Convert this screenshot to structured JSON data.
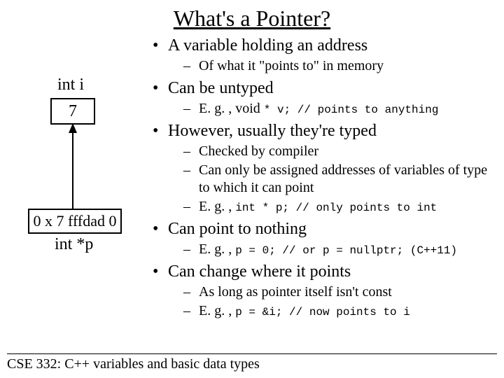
{
  "title": "What's a Pointer?",
  "footer": "CSE 332: C++ variables and basic data types",
  "diagram": {
    "var_label": "int i",
    "var_value": "7",
    "ptr_box": "0 x 7 fffdad 0",
    "ptr_label": "int *p"
  },
  "bullets": {
    "b1": "A variable holding an address",
    "b1a": "Of what it \"points to\" in memory",
    "b2": "Can be untyped",
    "b2a_pre": "E. g. , void ",
    "b2a_code": "* v; // points to anything",
    "b3": "However, usually they're typed",
    "b3a": "Checked by compiler",
    "b3b": "Can only be assigned addresses of variables of type to which it can point",
    "b3c_pre": "E. g. , ",
    "b3c_code": "int * p; // only points to int",
    "b4": "Can point to nothing",
    "b4a_pre": " E. g. , ",
    "b4a_code": "p = 0; // or p = nullptr; (C++11)",
    "b5": "Can change where it points",
    "b5a": "As long as pointer itself isn't const",
    "b5b_pre": "E. g. , ",
    "b5b_code": "p = &i; // now points to i"
  }
}
